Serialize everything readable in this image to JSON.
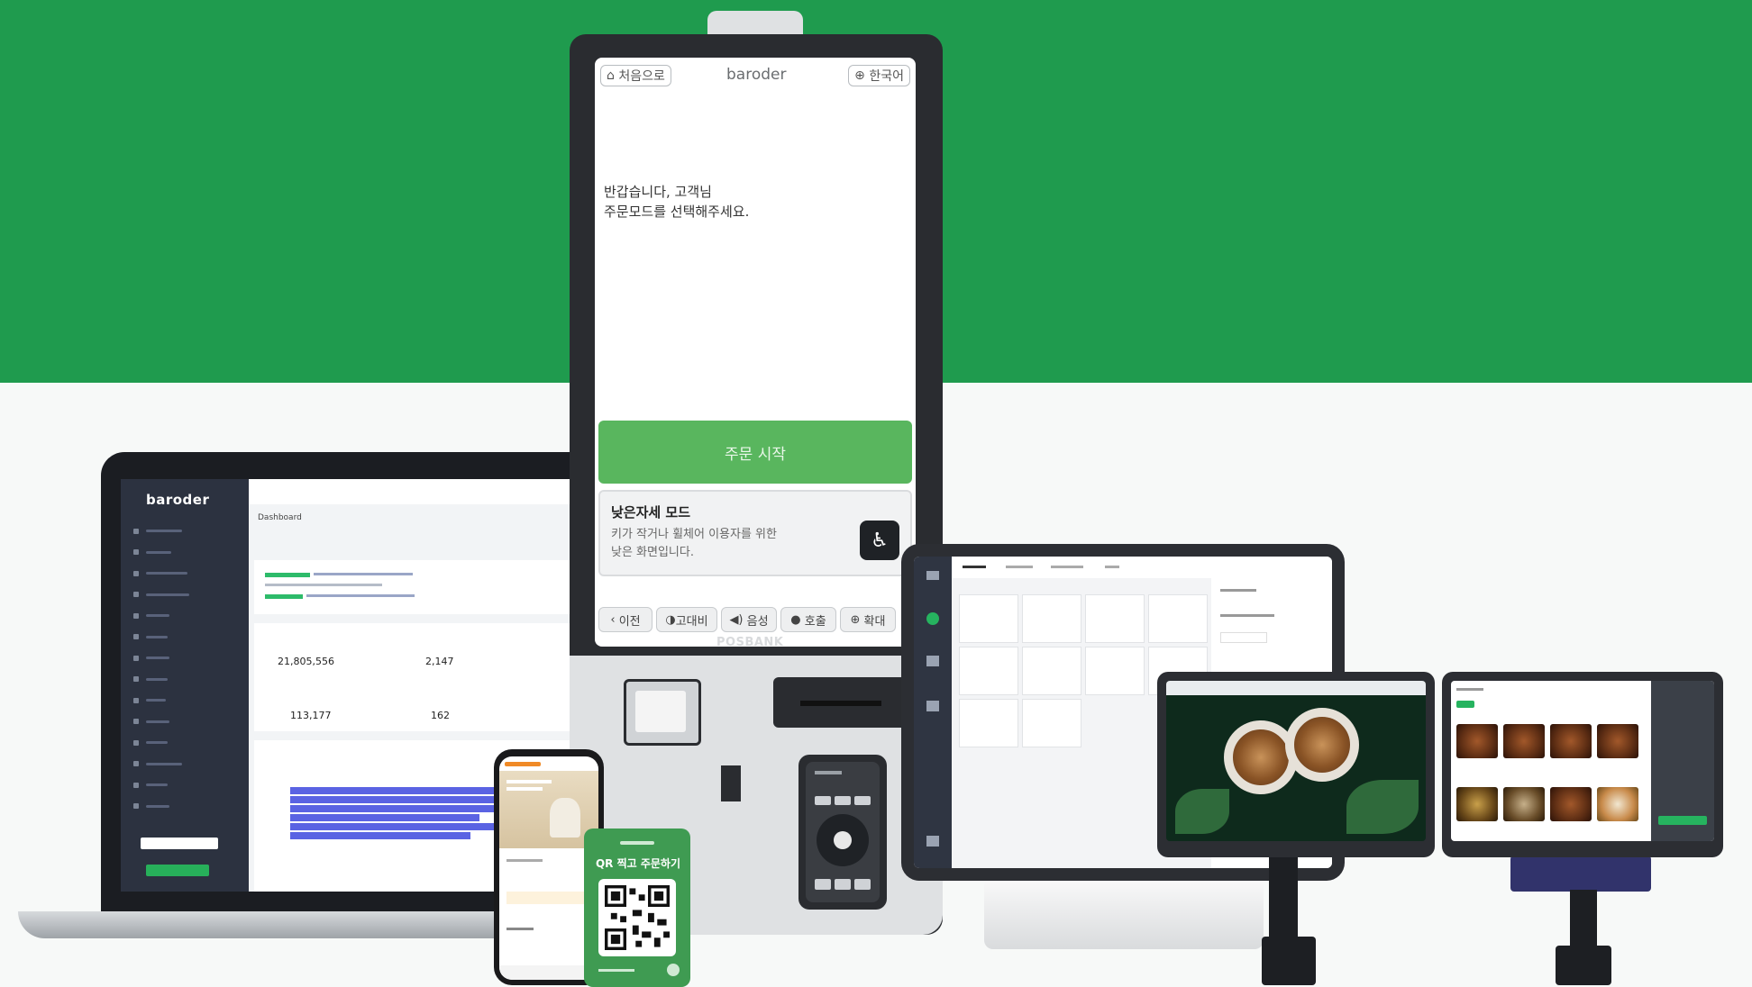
{
  "colors": {
    "brand_green": "#1f9b4e",
    "start_green": "#59b65e",
    "background": "#f7f9f8"
  },
  "kiosk": {
    "home_label": "처음으로",
    "brand": "baroder",
    "language_label": "한국어",
    "greeting": "반갑습니다, 고객님\n주문모드를 선택해주세요.",
    "start_button": "주문 시작",
    "low_mode_title": "낮은자세 모드",
    "low_mode_desc": "키가 작거나 휠체어 이용자를 위한\n낮은 화면입니다.",
    "bottom_buttons": [
      "이전",
      "고대비",
      "음성",
      "호출",
      "확대"
    ],
    "manufacturer": "POSBANK"
  },
  "laptop": {
    "logo": "baroder",
    "page_title": "Dashboard",
    "stats": [
      "21,805,556",
      "2,147",
      "113,177",
      "162"
    ]
  },
  "qr": {
    "title": "QR 찍고 주문하기"
  },
  "icons": [
    "home-icon",
    "globe-icon",
    "wheelchair-icon",
    "chevron-left-icon",
    "contrast-icon",
    "speaker-icon",
    "bell-icon",
    "zoom-icon"
  ]
}
